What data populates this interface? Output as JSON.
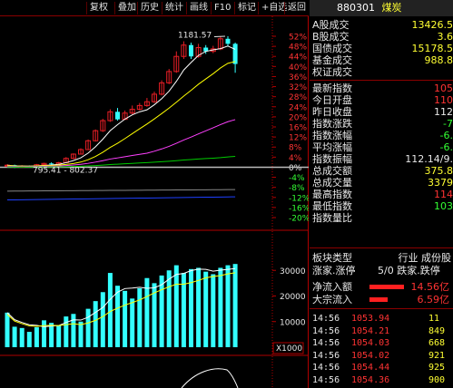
{
  "toolbar": {
    "items": [
      "复权",
      "叠加",
      "历史",
      "统计",
      "画线",
      "F10",
      "标记",
      "+自选",
      "返回"
    ]
  },
  "chart": {
    "price_axis": [
      "52%",
      "48%",
      "44%",
      "40%",
      "36%",
      "32%",
      "28%",
      "24%",
      "20%",
      "16%",
      "12%",
      "8%",
      "4%",
      "0%",
      "-4%",
      "-8%",
      "-12%",
      "-16%",
      "-20%"
    ],
    "high_label": "1181.57",
    "range_label": "795.41 - 802.37",
    "volume_axis": [
      "30000",
      "20000",
      "10000"
    ],
    "volume_unit": "X1000",
    "colors": {
      "up": "#e81e25",
      "down": "#33ffff",
      "ma1": "#ffffff",
      "ma2": "#ffff00",
      "ma3": "#ff40ff",
      "ma4": "#00cc00",
      "ma5": "#1e40ff"
    }
  },
  "chart_data": {
    "type": "candlestick",
    "y_unit": "percent_change",
    "ylim": [
      -20,
      52
    ],
    "candles": [
      {
        "o": 0.5,
        "c": 0.8,
        "h": 1.2,
        "l": 0.0
      },
      {
        "o": 0.8,
        "c": 0.2,
        "h": 1.0,
        "l": -0.3
      },
      {
        "o": 0.2,
        "c": 0.4,
        "h": 0.8,
        "l": 0.0
      },
      {
        "o": 0.4,
        "c": 0.3,
        "h": 0.7,
        "l": 0.0
      },
      {
        "o": 0.3,
        "c": 1.0,
        "h": 1.3,
        "l": 0.1
      },
      {
        "o": 1.0,
        "c": 1.5,
        "h": 1.8,
        "l": 0.7
      },
      {
        "o": 1.5,
        "c": 1.2,
        "h": 1.9,
        "l": 1.0
      },
      {
        "o": 1.2,
        "c": 1.8,
        "h": 2.1,
        "l": 1.0
      },
      {
        "o": 1.8,
        "c": 3.5,
        "h": 4.0,
        "l": 1.6
      },
      {
        "o": 3.5,
        "c": 5.2,
        "h": 5.5,
        "l": 3.2
      },
      {
        "o": 5.2,
        "c": 7.0,
        "h": 7.5,
        "l": 5.0
      },
      {
        "o": 7.0,
        "c": 10.5,
        "h": 11.0,
        "l": 6.8
      },
      {
        "o": 10.5,
        "c": 14.5,
        "h": 15.0,
        "l": 10.2
      },
      {
        "o": 14.5,
        "c": 18.5,
        "h": 19.2,
        "l": 14.0
      },
      {
        "o": 18.5,
        "c": 22.0,
        "h": 23.0,
        "l": 18.0
      },
      {
        "o": 22.0,
        "c": 19.0,
        "h": 23.5,
        "l": 18.5
      },
      {
        "o": 19.0,
        "c": 21.5,
        "h": 22.5,
        "l": 18.8
      },
      {
        "o": 21.5,
        "c": 23.0,
        "h": 24.5,
        "l": 21.0
      },
      {
        "o": 23.0,
        "c": 24.5,
        "h": 25.5,
        "l": 22.5
      },
      {
        "o": 24.5,
        "c": 26.0,
        "h": 27.5,
        "l": 24.0
      },
      {
        "o": 26.0,
        "c": 29.0,
        "h": 30.0,
        "l": 25.5
      },
      {
        "o": 29.0,
        "c": 33.5,
        "h": 34.5,
        "l": 28.5
      },
      {
        "o": 33.5,
        "c": 38.0,
        "h": 39.0,
        "l": 33.0
      },
      {
        "o": 38.0,
        "c": 44.0,
        "h": 46.0,
        "l": 37.5
      },
      {
        "o": 44.0,
        "c": 48.5,
        "h": 50.0,
        "l": 43.0
      },
      {
        "o": 48.5,
        "c": 44.0,
        "h": 49.5,
        "l": 43.0
      },
      {
        "o": 44.0,
        "c": 47.5,
        "h": 49.0,
        "l": 43.5
      },
      {
        "o": 47.5,
        "c": 46.0,
        "h": 48.5,
        "l": 45.0
      },
      {
        "o": 46.0,
        "c": 47.0,
        "h": 48.2,
        "l": 45.3
      },
      {
        "o": 47.0,
        "c": 51.0,
        "h": 52.0,
        "l": 46.5
      },
      {
        "o": 51.0,
        "c": 49.0,
        "h": 52.0,
        "l": 48.0
      },
      {
        "o": 49.0,
        "c": 41.0,
        "h": 49.5,
        "l": 37.5
      }
    ],
    "volume": [
      13500,
      8000,
      7500,
      6000,
      7800,
      10500,
      9500,
      8500,
      12000,
      13000,
      10000,
      15000,
      18000,
      21500,
      29000,
      24000,
      22000,
      19000,
      23000,
      27000,
      25000,
      28000,
      30000,
      32000,
      29000,
      30500,
      31000,
      29500,
      28500,
      31000,
      32000,
      32500
    ]
  },
  "panel": {
    "code": "880301",
    "name": "煤炭",
    "rows": [
      {
        "label": "A股成交",
        "value": "13426.5",
        "color": "#ffff33"
      },
      {
        "label": "B股成交",
        "value": "3.6",
        "color": "#ffff33"
      },
      {
        "label": "国债成交",
        "value": "15178.5",
        "color": "#ffff33"
      },
      {
        "label": "基金成交",
        "value": "988.8",
        "color": "#ffff33"
      },
      {
        "label": "权证成交",
        "value": "",
        "color": "#ffff33"
      },
      {
        "label": "最新指数",
        "value": "105",
        "color": "#ff3333"
      },
      {
        "label": "今日开盘",
        "value": "110",
        "color": "#ff3333"
      },
      {
        "label": "昨日收盘",
        "value": "112",
        "color": "#e8e8e8"
      },
      {
        "label": "指数涨跌",
        "value": "-7",
        "color": "#33ff33"
      },
      {
        "label": "指数涨幅",
        "value": "-6.",
        "color": "#33ff33"
      },
      {
        "label": "平均涨幅",
        "value": "-6.",
        "color": "#33ff33"
      },
      {
        "label": "指数振幅",
        "value": "112.14/9.",
        "color": "#e8e8e8"
      },
      {
        "label": "总成交额",
        "value": "375.8",
        "color": "#ffff33"
      },
      {
        "label": "总成交量",
        "value": "3379",
        "color": "#ffff33"
      },
      {
        "label": "最高指数",
        "value": "114",
        "color": "#ff3333"
      },
      {
        "label": "最低指数",
        "value": "103",
        "color": "#33ff33"
      },
      {
        "label": "指数量比",
        "value": "",
        "color": "#e8e8e8"
      }
    ],
    "board_type_label": "板块类型",
    "board_type_value": "行业 成份股",
    "rise_fall_label": "涨家.涨停",
    "rise_fall_value": "5/0 跌家.跌停",
    "net_inflow_label": "净流入额",
    "net_inflow_value": "14.56亿",
    "block_inflow_label": "大宗流入",
    "block_inflow_value": "6.59亿",
    "ticks": [
      {
        "time": "14:56",
        "price": "1053.94",
        "vol": "11"
      },
      {
        "time": "14:56",
        "price": "1054.21",
        "vol": "849"
      },
      {
        "time": "14:56",
        "price": "1054.03",
        "vol": "668"
      },
      {
        "time": "14:56",
        "price": "1054.02",
        "vol": "921"
      },
      {
        "time": "14:56",
        "price": "1054.44",
        "vol": "925"
      },
      {
        "time": "14:56",
        "price": "1054.36",
        "vol": "900"
      }
    ]
  }
}
